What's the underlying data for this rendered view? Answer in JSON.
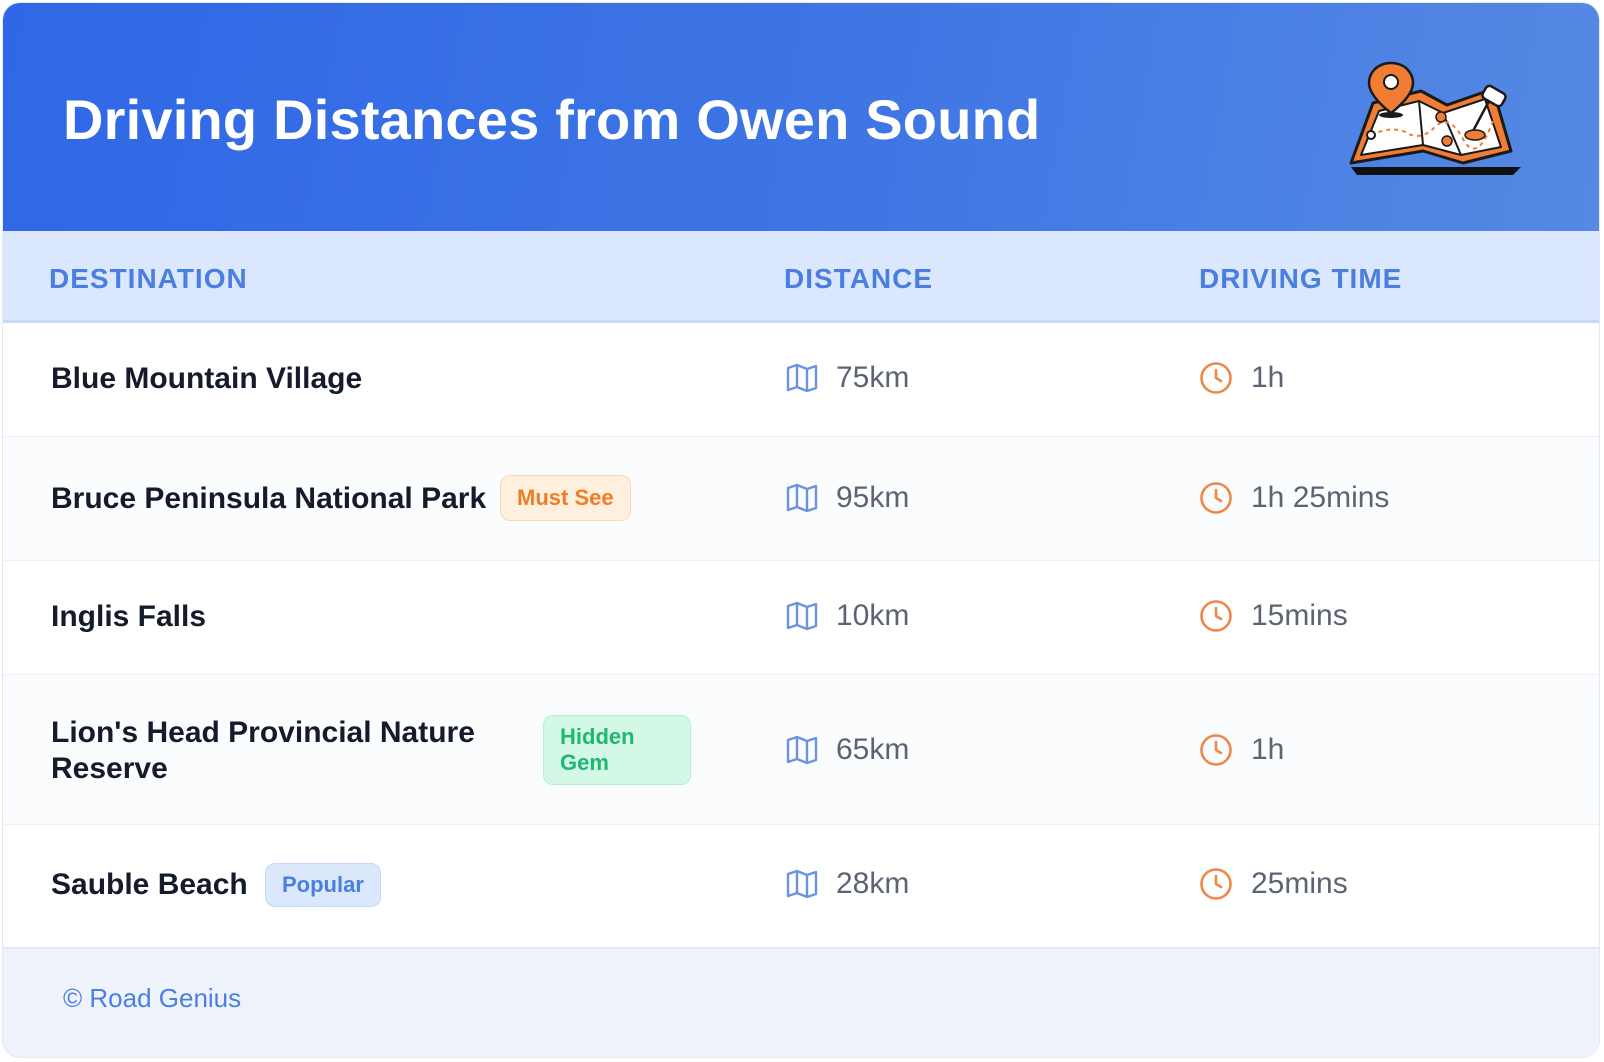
{
  "header": {
    "title": "Driving Distances from Owen Sound"
  },
  "table": {
    "columns": [
      "DESTINATION",
      "DISTANCE",
      "DRIVING TIME"
    ],
    "rows": [
      {
        "destination": "Blue Mountain Village",
        "badge": null,
        "distance": "75km",
        "time": "1h"
      },
      {
        "destination": "Bruce Peninsula National Park",
        "badge": "Must See",
        "distance": "95km",
        "time": "1h 25mins"
      },
      {
        "destination": "Inglis Falls",
        "badge": null,
        "distance": "10km",
        "time": "15mins"
      },
      {
        "destination": "Lion's Head Provincial Nature Reserve",
        "badge": "Hidden Gem",
        "distance": "65km",
        "time": "1h"
      },
      {
        "destination": "Sauble Beach",
        "badge": "Popular",
        "distance": "28km",
        "time": "25mins"
      }
    ]
  },
  "footer": {
    "credit": "© Road Genius"
  },
  "icons": {
    "distance": "map-icon",
    "time": "clock-icon",
    "illustration": "map-pin-illustration"
  },
  "colors": {
    "header_gradient_start": "#2f67e6",
    "header_gradient_end": "#5689e3",
    "column_header": "#4a7fe0",
    "badge_must_see": "#ef7d26",
    "badge_hidden_gem": "#1fb872",
    "badge_popular": "#4a7fe0",
    "clock": "#f0874a",
    "map_icon": "#6b93e0"
  }
}
